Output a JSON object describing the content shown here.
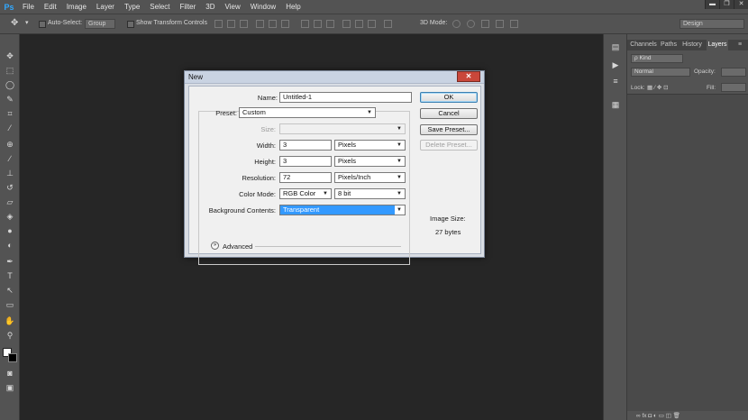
{
  "app": {
    "logo": "Ps"
  },
  "menubar": {
    "items": [
      "File",
      "Edit",
      "Image",
      "Layer",
      "Type",
      "Select",
      "Filter",
      "3D",
      "View",
      "Window",
      "Help"
    ],
    "window_controls": {
      "minimize": "▬",
      "restore": "❐",
      "close": "✕"
    }
  },
  "optionsbar": {
    "auto_select": "Auto-Select:",
    "auto_select_value": "Group",
    "show_transform": "Show Transform Controls",
    "mode_3d": "3D Mode:",
    "workspace": "Design"
  },
  "panel": {
    "tabs": [
      "Channels",
      "Paths",
      "History",
      "Layers"
    ],
    "active_tab": "Layers",
    "filter_kind": "ρ Kind",
    "blend_mode": "Normal",
    "opacity_label": "Opacity:",
    "lock_label": "Lock:",
    "fill_label": "Fill:"
  },
  "dialog": {
    "title": "New",
    "close": "✕",
    "name_label": "Name:",
    "name_value": "Untitled-1",
    "preset_label": "Preset:",
    "preset_value": "Custom",
    "size_label": "Size:",
    "size_value": "",
    "width_label": "Width:",
    "width_value": "3",
    "width_unit": "Pixels",
    "height_label": "Height:",
    "height_value": "3",
    "height_unit": "Pixels",
    "resolution_label": "Resolution:",
    "resolution_value": "72",
    "resolution_unit": "Pixels/Inch",
    "color_mode_label": "Color Mode:",
    "color_mode_value": "RGB Color",
    "bit_depth": "8 bit",
    "background_label": "Background Contents:",
    "background_value": "Transparent",
    "advanced_label": "Advanced",
    "ok": "OK",
    "cancel": "Cancel",
    "save_preset": "Save Preset...",
    "delete_preset": "Delete Preset...",
    "image_size_label": "Image Size:",
    "image_size_value": "27 bytes"
  },
  "colors": {
    "accent": "#31a8ff",
    "selection": "#3399ff",
    "ui_bg": "#535353",
    "canvas_bg": "#262626"
  }
}
